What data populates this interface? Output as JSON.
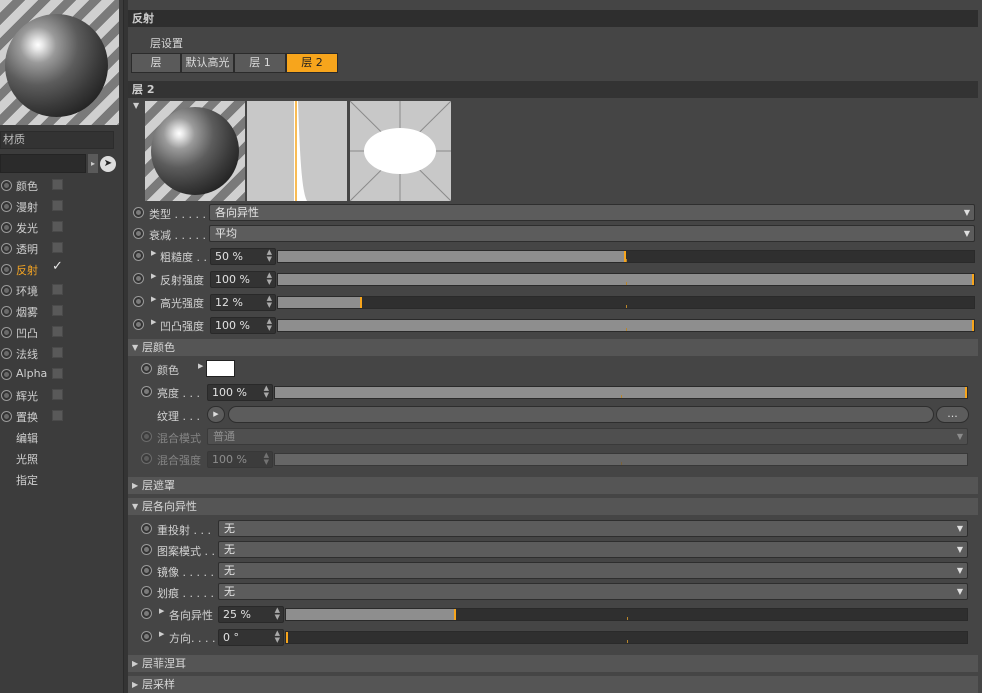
{
  "left": {
    "material_label": "材质",
    "channels": [
      {
        "label": "颜色",
        "checked": false
      },
      {
        "label": "漫射",
        "checked": false
      },
      {
        "label": "发光",
        "checked": false
      },
      {
        "label": "透明",
        "checked": false
      },
      {
        "label": "反射",
        "checked": true,
        "active": true
      },
      {
        "label": "环境",
        "checked": false
      },
      {
        "label": "烟雾",
        "checked": false
      },
      {
        "label": "凹凸",
        "checked": false
      },
      {
        "label": "法线",
        "checked": false
      },
      {
        "label": "Alpha",
        "checked": false
      },
      {
        "label": "辉光",
        "checked": false
      },
      {
        "label": "置换",
        "checked": false
      }
    ],
    "extras": [
      "编辑",
      "光照",
      "指定"
    ]
  },
  "right": {
    "header": "反射",
    "layer_settings": "层设置",
    "tabs": [
      "层",
      "默认高光",
      "层 1",
      "层 2"
    ],
    "selected_tab": 3,
    "layer_header": "层 2",
    "type_label": "类型 . . . . .",
    "type_value": "各向异性",
    "attenuation_label": "衰减 . . . . .",
    "attenuation_value": "平均",
    "roughness_label": "粗糙度 . .",
    "roughness_value": "50 %",
    "reflection_strength_label": "反射强度",
    "reflection_strength_value": "100 %",
    "specular_strength_label": "高光强度",
    "specular_strength_value": "12 %",
    "bump_strength_label": "凹凸强度",
    "bump_strength_value": "100 %",
    "layer_color": {
      "title": "层颜色",
      "color_label": "颜色",
      "brightness_label": "亮度 . . .",
      "brightness_value": "100 %",
      "texture_label": "纹理 . . .",
      "texture_more": "...",
      "blend_mode_label": "混合模式",
      "blend_mode_value": "普通",
      "blend_strength_label": "混合强度",
      "blend_strength_value": "100 %"
    },
    "layer_mask": "层遮罩",
    "anisotropy": {
      "title": "层各向异性",
      "reproject_label": "重投射 . . .",
      "reproject_value": "无",
      "pattern_label": "图案模式 . .",
      "pattern_value": "无",
      "mirror_label": "镜像 . . . . .",
      "mirror_value": "无",
      "scratch_label": "划痕 . . . . .",
      "scratch_value": "无",
      "aniso_label": "各向异性",
      "aniso_value": "25 %",
      "direction_label": "方向. . . .",
      "direction_value": "0 °"
    },
    "fresnel": "层菲涅耳",
    "sampling": "层采样"
  },
  "sliders": {
    "roughness": 0.5,
    "reflection_strength": 1.0,
    "specular_strength": 0.12,
    "bump_strength": 1.0,
    "brightness": 1.0,
    "blend_strength": 1.0,
    "anisotropy": 0.25,
    "direction": 0.0
  },
  "colors": {
    "accent": "#f7a51c",
    "layer_color": "#ffffff"
  }
}
